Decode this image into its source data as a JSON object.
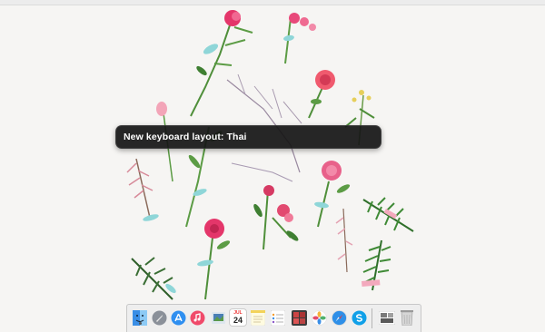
{
  "hud": {
    "text": "New keyboard layout: Thai"
  },
  "dock": {
    "calendar": {
      "month": "JUL",
      "day": "24"
    },
    "apps": [
      {
        "name": "Finder"
      },
      {
        "name": "Launchpad"
      },
      {
        "name": "App Store"
      },
      {
        "name": "iTunes"
      },
      {
        "name": "Preview"
      },
      {
        "name": "Calendar"
      },
      {
        "name": "Notes"
      },
      {
        "name": "Reminders"
      },
      {
        "name": "Photo Booth"
      },
      {
        "name": "Photos"
      },
      {
        "name": "Safari"
      },
      {
        "name": "Skype"
      },
      {
        "name": "Downloads"
      },
      {
        "name": "Trash"
      }
    ]
  },
  "colors": {
    "wallpaper": "#f6f5f3",
    "hud_bg": "#161616",
    "flower_pink": "#e4366a",
    "flower_coral": "#f05a6e",
    "stem_green": "#4f8f3a",
    "tape_blue": "#8fd6d8"
  }
}
